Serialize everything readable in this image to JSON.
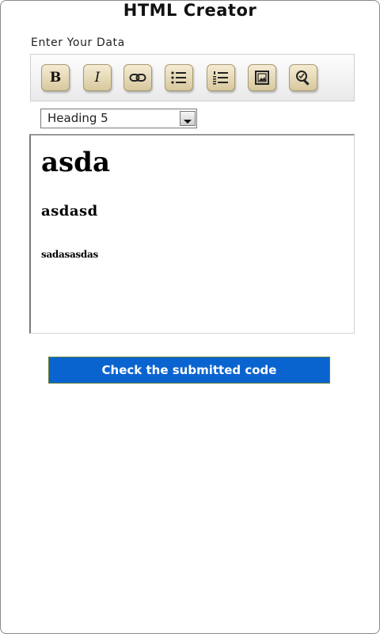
{
  "app": {
    "title": "HTML Creator"
  },
  "form": {
    "label": "Enter Your Data"
  },
  "toolbar": {
    "bold_label": "B",
    "italic_label": "I",
    "icons": [
      "bold-icon",
      "italic-icon",
      "link-icon",
      "bulleted-list-icon",
      "numbered-list-icon",
      "image-icon",
      "search-icon"
    ]
  },
  "format_select": {
    "selected": "Heading 5"
  },
  "editor": {
    "heading1": "asda",
    "heading3": "asdasd",
    "heading5": "sadasasdas"
  },
  "actions": {
    "submit_label": "Check the submitted code"
  },
  "colors": {
    "accent": "#0a64d0",
    "button_face": "#e6dab5"
  }
}
